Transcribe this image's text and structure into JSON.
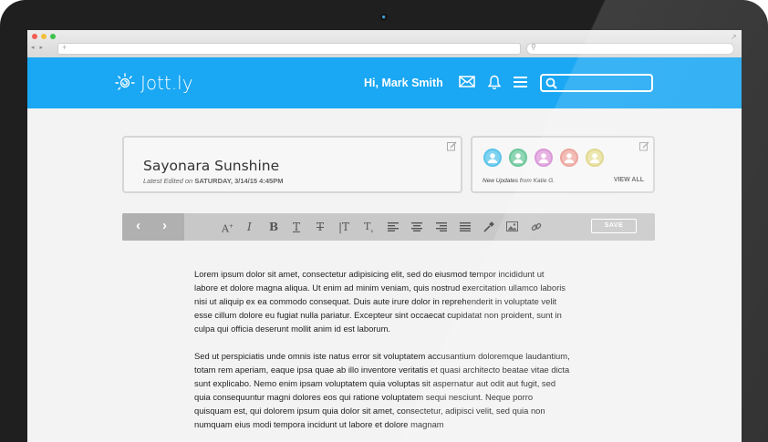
{
  "browser": {
    "nav_arrows": "◂ ▸",
    "address_value": "",
    "search_value": ""
  },
  "header": {
    "logo_text": "Jott.ly",
    "greeting": "Hi, Mark Smith",
    "search_value": "",
    "accent_color": "#1aa7f3"
  },
  "document": {
    "title": "Sayonara Sunshine",
    "meta_label": "Latest Edited on",
    "meta_date": "SATURDAY, 3/14/15 4:45PM"
  },
  "updates": {
    "text": "New Updates from Katie G.",
    "view_all": "VIEW ALL",
    "avatars": [
      {
        "color": "#7fd3f0",
        "border": "#5bc4ec",
        "icon": "user-icon"
      },
      {
        "color": "#8fd6b4",
        "border": "#6cc79a",
        "icon": "user-icon"
      },
      {
        "color": "#e3a6e0",
        "border": "#d487d1",
        "icon": "user-icon"
      },
      {
        "color": "#f0b3ab",
        "border": "#e8998f",
        "icon": "user-icon"
      },
      {
        "color": "#e9e2a4",
        "border": "#dcd37f",
        "icon": "user-icon"
      }
    ]
  },
  "toolbar": {
    "back": "‹",
    "forward": "›",
    "save_label": "SAVE",
    "tools": [
      "font-size-icon",
      "italic-icon",
      "bold-icon",
      "underline-icon",
      "strikethrough-icon",
      "text-height-icon",
      "subscript-icon",
      "align-left-icon",
      "align-center-icon",
      "align-right-icon",
      "justify-icon",
      "eyedropper-icon",
      "image-icon",
      "link-icon"
    ]
  },
  "body": {
    "paragraphs": [
      "Lorem ipsum dolor sit amet, consectetur adipisicing elit, sed do eiusmod tempor incididunt ut labore et dolore magna aliqua. Ut enim ad minim veniam, quis nostrud exercitation ullamco laboris nisi ut aliquip ex ea commodo consequat. Duis aute irure dolor in reprehenderit in voluptate velit esse cillum dolore eu fugiat nulla pariatur. Excepteur sint occaecat cupidatat non proident, sunt in culpa qui officia deserunt mollit anim id est laborum.",
      "Sed ut perspiciatis unde omnis iste natus error sit voluptatem accusantium doloremque laudantium, totam rem aperiam, eaque ipsa quae ab illo inventore veritatis et quasi architecto beatae vitae dicta sunt explicabo. Nemo enim ipsam voluptatem quia voluptas sit aspernatur aut odit aut fugit, sed quia consequuntur magni dolores eos qui ratione voluptatem sequi nesciunt. Neque porro quisquam est, qui dolorem ipsum quia dolor sit amet, consectetur, adipisci velit, sed quia non numquam eius modi tempora incidunt ut labore et dolore magnam"
    ]
  }
}
